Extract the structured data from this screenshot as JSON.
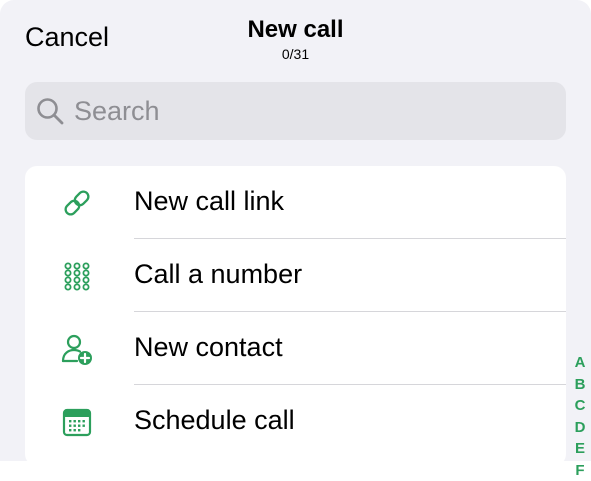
{
  "header": {
    "cancel_label": "Cancel",
    "title": "New call",
    "selection_count": "0/31"
  },
  "search": {
    "placeholder": "Search",
    "value": ""
  },
  "actions": [
    {
      "label": "New call link",
      "icon": "link-icon"
    },
    {
      "label": "Call a number",
      "icon": "keypad-icon"
    },
    {
      "label": "New contact",
      "icon": "add-contact-icon"
    },
    {
      "label": "Schedule call",
      "icon": "calendar-icon"
    }
  ],
  "section_index": [
    "A",
    "B",
    "C",
    "D",
    "E",
    "F"
  ],
  "colors": {
    "accent": "#2c9f5c",
    "background": "#f2f2f7",
    "card": "#ffffff",
    "search_fill": "#e4e4e9",
    "placeholder": "#8e8e93"
  }
}
